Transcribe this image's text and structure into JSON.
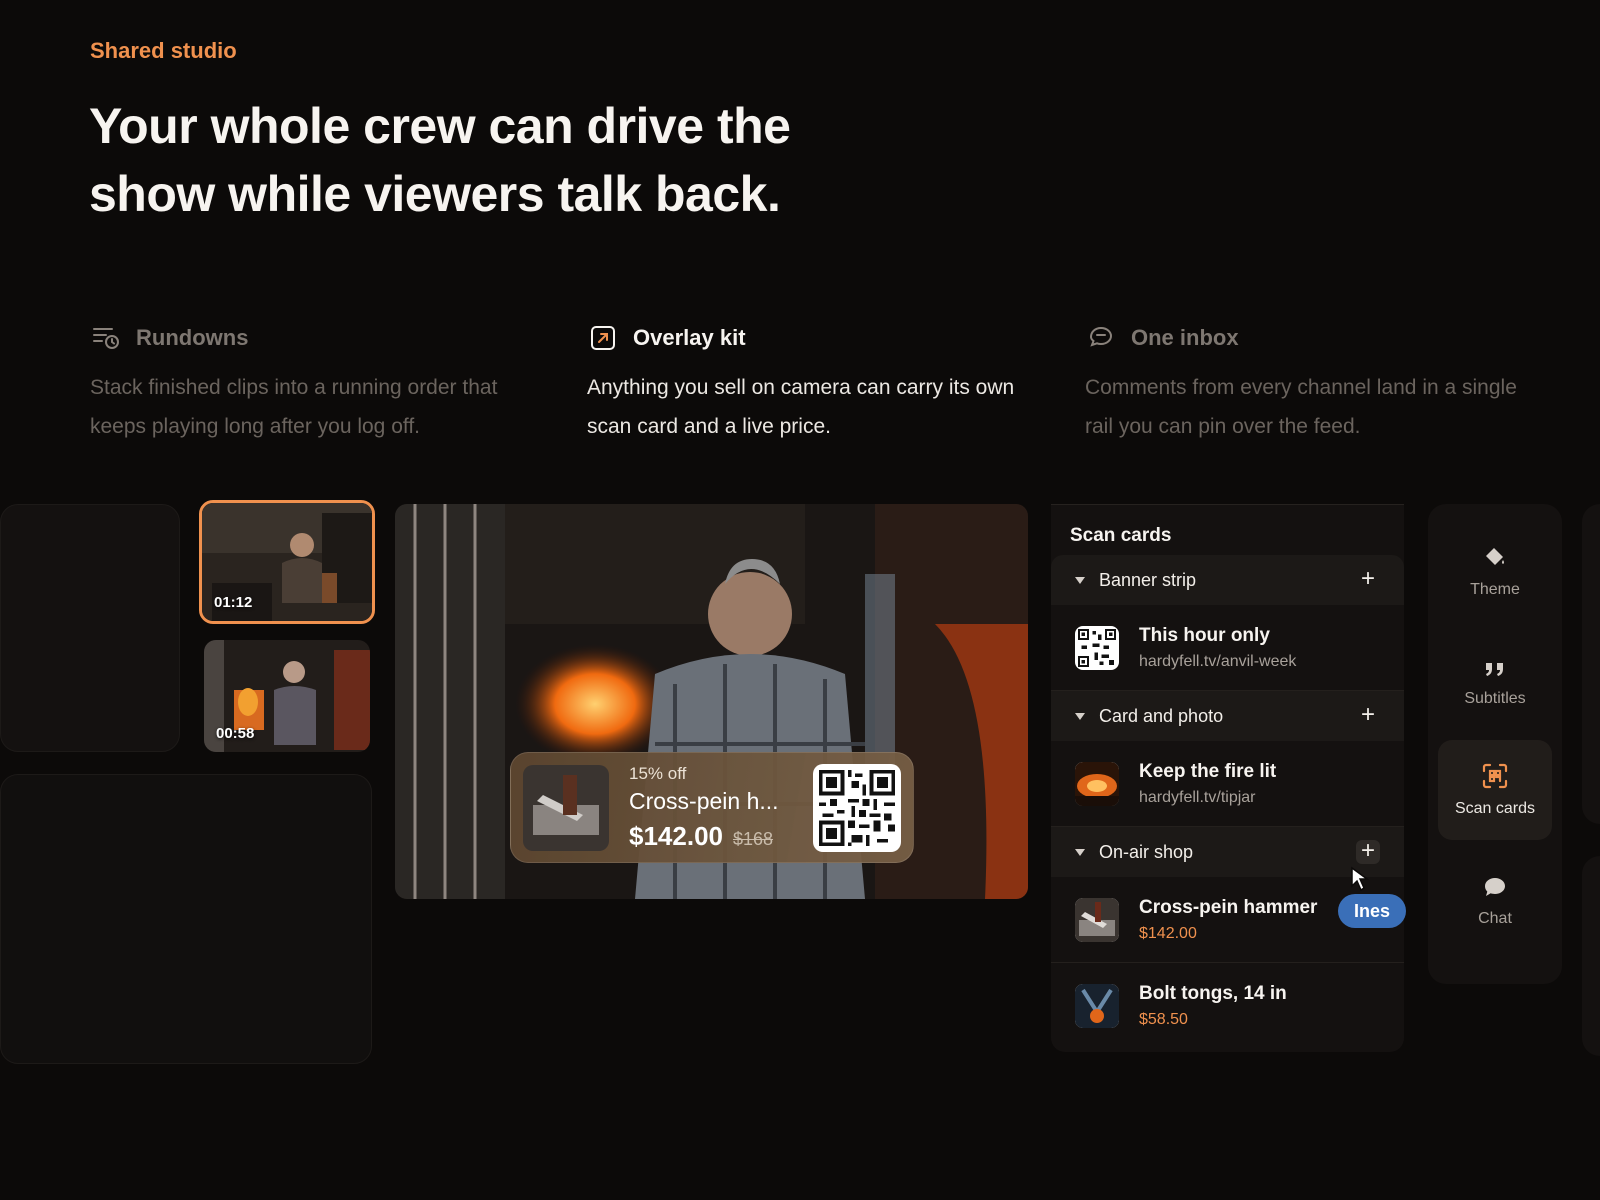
{
  "eyebrow": "Shared studio",
  "headline": "Your whole crew can drive the show while viewers talk back.",
  "features": [
    {
      "title": "Rundowns",
      "description": "Stack finished clips into a running order that keeps playing long after you log off.",
      "icon": "rundown-clock-icon"
    },
    {
      "title": "Overlay kit",
      "description": "Anything you sell on camera can carry its own scan card and a live price.",
      "icon": "overlay-arrow-icon"
    },
    {
      "title": "One inbox",
      "description": "Comments from every channel land in a single rail you can pin over the feed.",
      "icon": "chat-bubble-icon"
    }
  ],
  "clips": [
    {
      "time": "01:12"
    },
    {
      "time": "00:58"
    }
  ],
  "product_card": {
    "discount": "15% off",
    "name": "Cross-pein h...",
    "price": "$142.00",
    "old_price": "$168"
  },
  "panel": {
    "title": "Scan cards",
    "groups": [
      {
        "name": "Banner strip",
        "items": [
          {
            "name": "This hour only",
            "sub": "hardyfell.tv/anvil-week"
          }
        ]
      },
      {
        "name": "Card and photo",
        "items": [
          {
            "name": "Keep the fire lit",
            "sub": "hardyfell.tv/tipjar"
          }
        ]
      },
      {
        "name": "On-air shop",
        "items": [
          {
            "name": "Cross-pein hammer",
            "sub": "$142.00"
          },
          {
            "name": "Bolt tongs, 14 in",
            "sub": "$58.50"
          }
        ]
      }
    ],
    "add_symbol": "+"
  },
  "collaborator": "Ines",
  "rail": [
    {
      "label": "Theme",
      "icon": "paint-bucket-icon"
    },
    {
      "label": "Subtitles",
      "icon": "quote-icon"
    },
    {
      "label": "Scan cards",
      "icon": "scan-qr-icon"
    },
    {
      "label": "Chat",
      "icon": "chat-bubble-icon"
    }
  ],
  "colors": {
    "accent": "#f0914e",
    "background": "#0c0a09",
    "collaborator": "#3a6fb8"
  }
}
